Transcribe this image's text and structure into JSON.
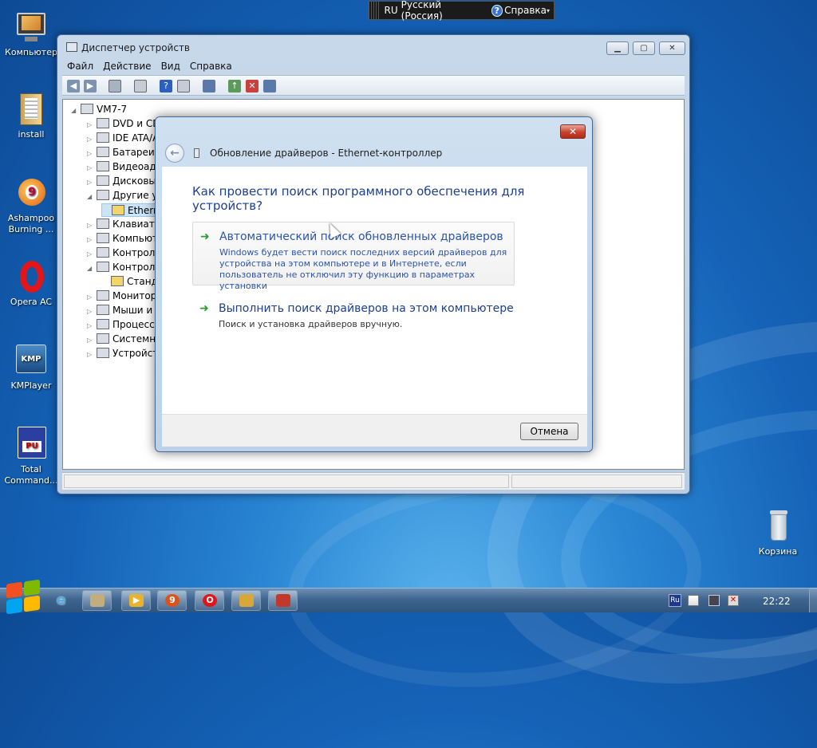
{
  "language_bar": {
    "lang_code": "RU",
    "lang_name": "Русский (Россия)",
    "help_label": "Справка"
  },
  "desktop_icons": [
    {
      "name": "desktop-icon-computer",
      "label": "Компьютер",
      "icon": "computer-icon"
    },
    {
      "name": "desktop-icon-install",
      "label": "install",
      "icon": "folder-icon"
    },
    {
      "name": "desktop-icon-ashampoo",
      "label": "Ashampoo Burning ...",
      "icon": "ashampoo-icon"
    },
    {
      "name": "desktop-icon-opera",
      "label": "Opera AC",
      "icon": "opera-icon"
    },
    {
      "name": "desktop-icon-kmplayer",
      "label": "KMPlayer",
      "icon": "kmp-icon"
    },
    {
      "name": "desktop-icon-totalcmd",
      "label": "Total Command...",
      "icon": "totalcmd-icon"
    },
    {
      "name": "desktop-icon-recycle",
      "label": "Корзина",
      "icon": "recycle-bin-icon"
    }
  ],
  "device_manager": {
    "title": "Диспетчер устройств",
    "menu": [
      "Файл",
      "Действие",
      "Вид",
      "Справка"
    ],
    "tree": {
      "root": "VM7-7",
      "items": [
        "DVD и CD",
        "IDE ATA/A",
        "Батареи",
        "Видеоада",
        "Дисковые",
        "Другие ус",
        "Ethern",
        "Клавиату",
        "Компьют",
        "Контролл",
        "Контролл",
        "Станд",
        "Монитор",
        "Мыши и",
        "Процессо",
        "Системн",
        "Устройст"
      ]
    }
  },
  "dialog": {
    "title": "Обновление драйверов - Ethernet-контроллер",
    "question": "Как провести поиск программного обеспечения для устройств?",
    "option1": {
      "title": "Автоматический поиск обновленных драйверов",
      "desc_line1": "Windows будет вести поиск последних версий драйверов для",
      "desc_line2": "устройства на этом компьютере и в Интернете, если",
      "desc_line3": "пользователь не отключил эту функцию в параметрах установки"
    },
    "option2": {
      "title": "Выполнить поиск драйверов на этом компьютере",
      "desc": "Поиск и установка драйверов вручную."
    },
    "cancel_label": "Отмена"
  },
  "taskbar": {
    "tray_lang": "Ru",
    "clock": "22:22"
  },
  "colors": {
    "dialog_link": "#1c3f94",
    "option_arrow": "#2e9b2e",
    "close_red": "#c9412c"
  }
}
